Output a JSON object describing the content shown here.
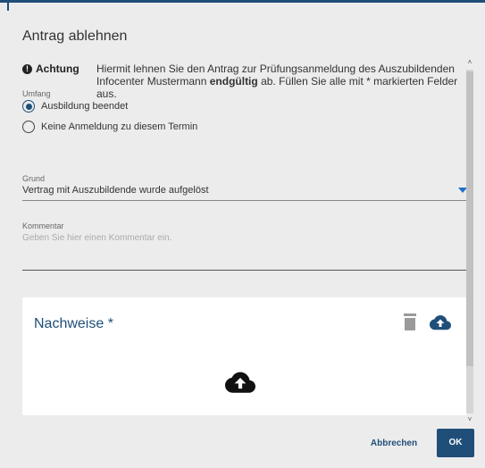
{
  "dialog": {
    "title": "Antrag ablehnen",
    "notice_label": "Achtung",
    "notice_text_1": "Hiermit lehnen Sie den Antrag zur Prüfungsanmeldung des Auszubildenden",
    "notice_text_2a": "Infocenter Mustermann ",
    "notice_text_2b": "endgültig",
    "notice_text_2c": " ab. Füllen Sie alle mit * markierten Felder aus."
  },
  "umfang": {
    "label": "Umfang",
    "options": [
      {
        "label": "Ausbildung beendet",
        "selected": true
      },
      {
        "label": "Keine Anmeldung zu diesem Termin",
        "selected": false
      }
    ]
  },
  "grund": {
    "label": "Grund",
    "value": "Vertrag mit Auszubildende wurde aufgelöst"
  },
  "kommentar": {
    "label": "Kommentar",
    "placeholder": "Geben Sie hier einen Kommentar ein."
  },
  "nachweise": {
    "title": "Nachweise *"
  },
  "actions": {
    "cancel": "Abbrechen",
    "ok": "OK"
  },
  "colors": {
    "primary": "#1f4e79",
    "accent": "#1f6fc9",
    "trash": "#9a9a9a"
  }
}
